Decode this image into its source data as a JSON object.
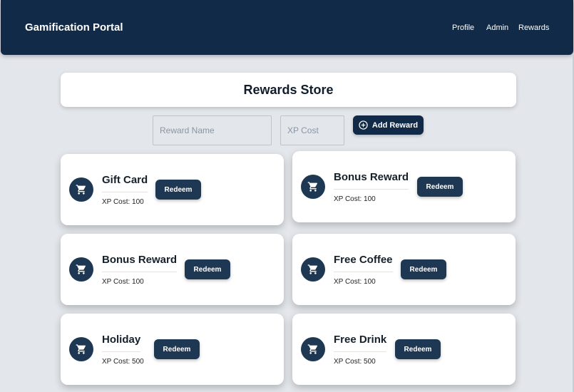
{
  "navbar": {
    "brand": "Gamification Portal",
    "links": [
      "Profile",
      "Admin",
      "Rewards"
    ]
  },
  "page": {
    "title": "Rewards Store"
  },
  "form": {
    "reward_name_placeholder": "Reward Name",
    "xp_cost_placeholder": "XP Cost",
    "add_button_label": "Add Reward",
    "add_icon": "plus-circle-icon"
  },
  "rewards": [
    {
      "title": "Gift Card",
      "xp": "XP Cost: 100",
      "button": "Redeem",
      "icon": "cart-icon"
    },
    {
      "title": "Bonus Reward",
      "xp": "XP Cost: 100",
      "button": "Redeem",
      "icon": "cart-icon"
    },
    {
      "title": "Bonus Reward",
      "xp": "XP Cost: 100",
      "button": "Redeem",
      "icon": "cart-icon"
    },
    {
      "title": "Free Coffee",
      "xp": "XP Cost: 100",
      "button": "Redeem",
      "icon": "cart-icon"
    },
    {
      "title": "Holiday",
      "xp": "XP Cost: 500",
      "button": "Redeem",
      "icon": "cart-icon"
    },
    {
      "title": "Free Drink",
      "xp": "XP Cost: 500",
      "button": "Redeem",
      "icon": "cart-icon"
    }
  ],
  "colors": {
    "navbar": "#112a47",
    "background": "#e3e6ea",
    "accent": "#1e3753",
    "card": "#ffffff"
  }
}
